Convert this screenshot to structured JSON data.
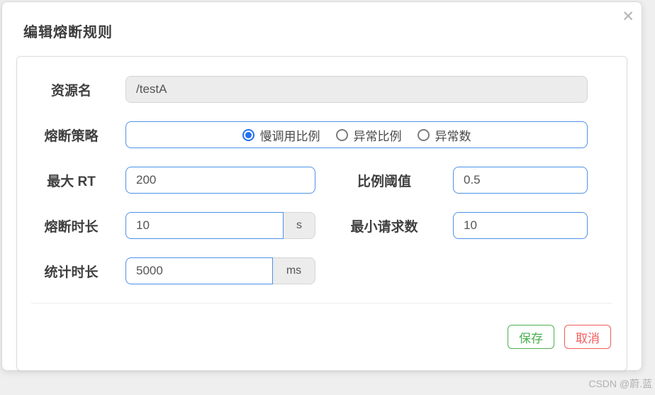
{
  "dialog": {
    "title": "编辑熔断规则",
    "close_icon": "✕"
  },
  "form": {
    "resource": {
      "label": "资源名",
      "value": "/testA"
    },
    "strategy": {
      "label": "熔断策略",
      "options": [
        {
          "label": "慢调用比例",
          "selected": true
        },
        {
          "label": "异常比例",
          "selected": false
        },
        {
          "label": "异常数",
          "selected": false
        }
      ]
    },
    "max_rt": {
      "label": "最大 RT",
      "value": "200"
    },
    "ratio_threshold": {
      "label": "比例阈值",
      "value": "0.5"
    },
    "recovery_timeout": {
      "label": "熔断时长",
      "value": "10",
      "unit": "s"
    },
    "min_request": {
      "label": "最小请求数",
      "value": "10"
    },
    "stat_interval": {
      "label": "统计时长",
      "value": "5000",
      "unit": "ms"
    }
  },
  "footer": {
    "save_label": "保存",
    "cancel_label": "取消"
  },
  "watermark": "CSDN @蔚.蓝",
  "colors": {
    "accent_blue": "#4d92e8",
    "radio_selected_blue": "#2470ee",
    "save_green": "#4caf50",
    "cancel_red": "#f25c5c",
    "disabled_input_bg": "#ececec",
    "page_background": "#efeff0"
  }
}
